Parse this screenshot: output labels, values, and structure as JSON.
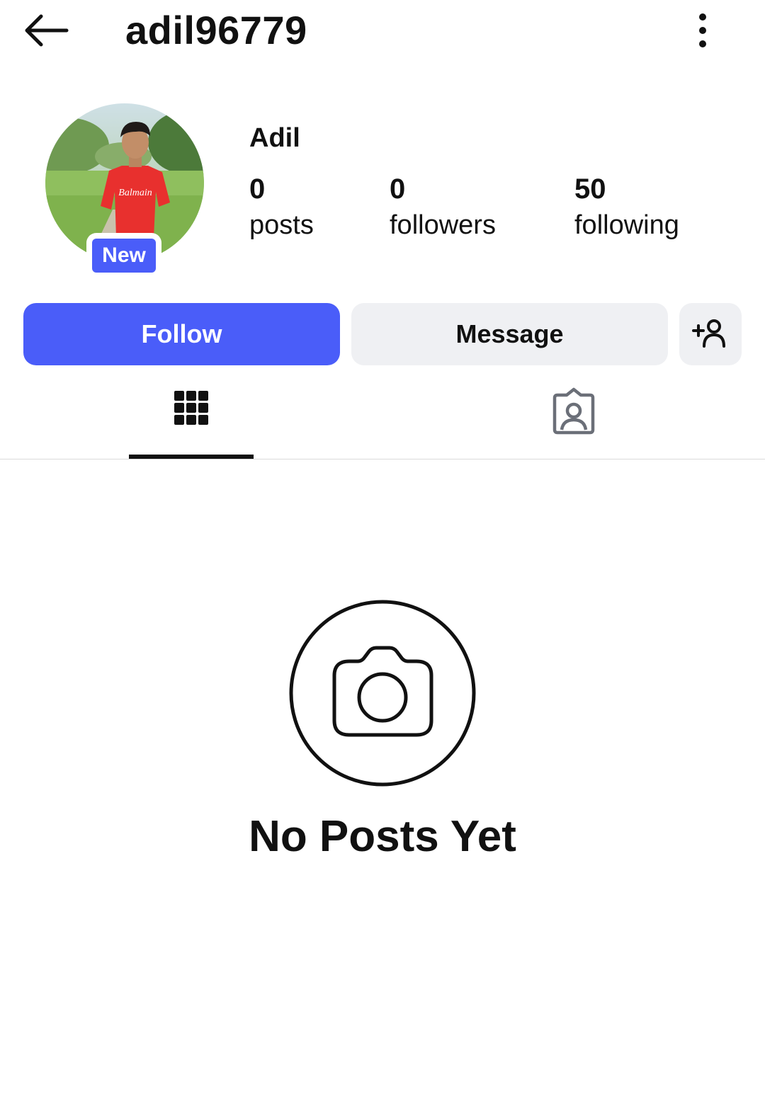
{
  "header": {
    "username": "adil96779"
  },
  "profile": {
    "display_name": "Adil",
    "badge": "New",
    "avatar_shirt_text": "Balmain",
    "stats": [
      {
        "value": "0",
        "label": "posts"
      },
      {
        "value": "0",
        "label": "followers"
      },
      {
        "value": "50",
        "label": "following"
      }
    ]
  },
  "actions": {
    "follow_label": "Follow",
    "message_label": "Message"
  },
  "tabs": [
    {
      "icon": "grid-icon",
      "active": true
    },
    {
      "icon": "tagged-icon",
      "active": false
    }
  ],
  "empty_state": {
    "icon": "camera-icon",
    "title": "No Posts Yet"
  },
  "colors": {
    "accent": "#4a5df9",
    "button_secondary": "#eff0f3",
    "text": "#111111"
  }
}
